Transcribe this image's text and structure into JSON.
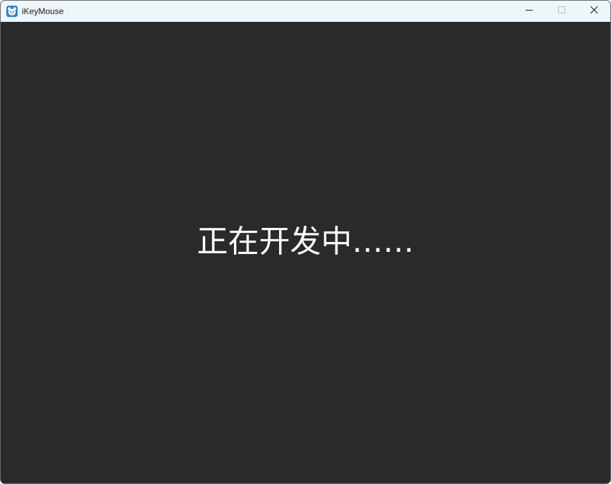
{
  "window": {
    "title": "iKeyMouse",
    "icon": "panda-app-icon"
  },
  "controls": {
    "minimize": "minimize-icon",
    "maximize": "maximize-icon",
    "close": "close-icon"
  },
  "content": {
    "message": "正在开发中……"
  },
  "colors": {
    "titlebar": "#eef6fa",
    "background": "#2b292a",
    "text": "#ffffff",
    "icon_accent": "#2f7fd0"
  }
}
